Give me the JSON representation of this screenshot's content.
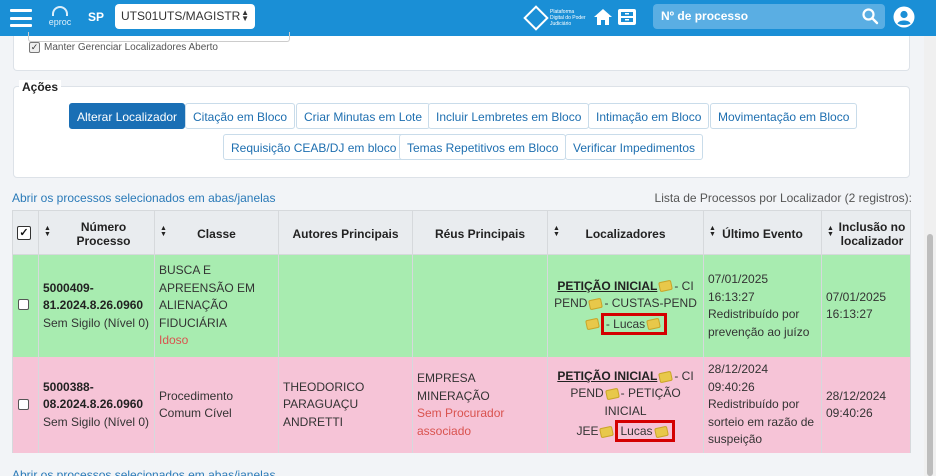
{
  "header": {
    "logo_text": "eproc",
    "uf": "SP",
    "unit_select": "UTS01UTS/MAGISTR",
    "pdpj_text": "Plataforma Digital do Poder Judiciário",
    "search_placeholder": "Nº de processo"
  },
  "top_panel": {
    "keep_open_label": "Manter Gerenciar Localizadores Aberto"
  },
  "actions": {
    "legend": "Ações",
    "buttons": [
      "Alterar Localizador",
      "Citação em Bloco",
      "Criar Minutas em Lote",
      "Incluir Lembretes em Bloco",
      "Intimação em Bloco",
      "Movimentação em Bloco",
      "Requisição CEAB/DJ em bloco",
      "Temas Repetitivos em Bloco",
      "Verificar Impedimentos"
    ]
  },
  "open_link": "Abrir os processos selecionados em abas/janelas",
  "list_info": "Lista de Processos por Localizador (2 registros):",
  "table": {
    "headers": [
      "Número Processo",
      "Classe",
      "Autores Principais",
      "Réus Principais",
      "Localizadores",
      "Último Evento",
      "Inclusão no localizador"
    ],
    "rows": [
      {
        "numero_1": "5000409-",
        "numero_2": "81.2024.8.26.0960",
        "sigilo": "Sem Sigilo (Nível 0)",
        "classe_1": "BUSCA E",
        "classe_2": "APREENSÃO EM",
        "classe_3": "ALIENAÇÃO",
        "classe_4": "FIDUCIÁRIA",
        "classe_tag": "Idoso",
        "autores_1": "",
        "autores_2": "",
        "reus": "",
        "reus_tag": "",
        "loc_link": "PETIÇÃO INICIAL",
        "loc_l1": "- CI",
        "loc_l2a": "PEND",
        "loc_l2b": "- CUSTAS-PEND",
        "loc_l3": "-",
        "loc_lucas": "Lucas",
        "evento_1": "07/01/2025",
        "evento_2": "16:13:27",
        "evento_3": "Redistribuído por",
        "evento_4": "prevenção ao juízo",
        "inclusao_1": "07/01/2025",
        "inclusao_2": "16:13:27"
      },
      {
        "numero_1": "5000388-",
        "numero_2": "08.2024.8.26.0960",
        "sigilo": "Sem Sigilo (Nível 0)",
        "classe_1": "Procedimento",
        "classe_2": "Comum Cível",
        "classe_3": "",
        "classe_4": "",
        "classe_tag": "",
        "autores_1": "THEODORICO",
        "autores_2": "PARAGUAÇU ANDRETTI",
        "reus": "EMPRESA MINERAÇÃO",
        "reus_tag_1": "Sem Procurador",
        "reus_tag_2": "associado",
        "loc_link": "PETIÇÃO INICIAL",
        "loc_l1": "- CI",
        "loc_l2a": "PEND",
        "loc_l2b": "- PETIÇÃO INICIAL",
        "loc_l3": "JEE",
        "loc_lucas": "Lucas",
        "evento_1": "28/12/2024",
        "evento_2": "09:40:26",
        "evento_3": "Redistribuído por",
        "evento_4": "sorteio em razão de",
        "evento_5": "suspeição",
        "inclusao_1": "28/12/2024",
        "inclusao_2": "09:40:26"
      }
    ]
  },
  "colors": {
    "header_bg": "#1a8fd6",
    "row_green": "#a8ecb0",
    "row_pink": "#f6c4d7",
    "primary_button": "#1a6fb5",
    "highlight_box": "#d40000"
  }
}
